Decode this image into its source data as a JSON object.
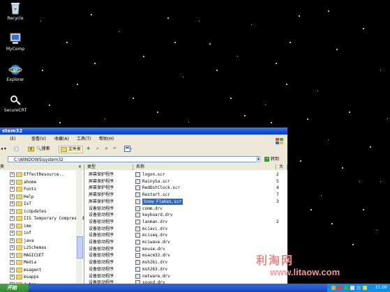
{
  "desktop": {
    "icons": [
      {
        "label": "Recycle",
        "icon": "recycle-bin-icon"
      },
      {
        "label": "MyComp",
        "icon": "my-computer-icon"
      },
      {
        "label": "Explorer",
        "icon": "internet-explorer-icon"
      },
      {
        "label": "SecureCRT",
        "icon": "securecrt-icon"
      }
    ]
  },
  "window": {
    "title": "stem32",
    "menu": [
      "(E)",
      "查看(V)",
      "收藏(A)",
      "工具(T)",
      "帮助(H)"
    ],
    "toolbar": {
      "search_label": "搜索",
      "folders_label": "文件夹"
    },
    "address": {
      "value": "C:\\WINDOWS\\system32",
      "go_label": "转到"
    },
    "left_header": "夹",
    "tree": [
      {
        "label": "EffectResource.."
      },
      {
        "label": "ahome"
      },
      {
        "label": "Fonts"
      },
      {
        "label": "Help"
      },
      {
        "label": "IsT"
      },
      {
        "label": "icUpdates"
      },
      {
        "label": "IIS Temporary Compressed"
      },
      {
        "label": "ime"
      },
      {
        "label": "inf"
      },
      {
        "label": "java"
      },
      {
        "label": "L2Schemas"
      },
      {
        "label": "MAGICSET"
      },
      {
        "label": "Media"
      },
      {
        "label": "msagent"
      },
      {
        "label": "msapps"
      },
      {
        "label": "d_tmp"
      }
    ],
    "columns": {
      "type": "类型",
      "name": "名称",
      "size": "大"
    },
    "files": [
      {
        "type": "屏幕保护程序",
        "name": "logon.scr",
        "size": "2"
      },
      {
        "type": "屏幕保护程序",
        "name": "RainySa.scr",
        "size": "5"
      },
      {
        "type": "屏幕保护程序",
        "name": "RedDotClock.scr",
        "size": "4"
      },
      {
        "type": "屏幕保护程序",
        "name": "Restart.scr",
        "size": "7"
      },
      {
        "type": "屏幕保护程序",
        "name": "Snow Flakes.scr",
        "size": "3",
        "selected": true
      },
      {
        "type": "设备驱动程序",
        "name": "comm.drv",
        "size": ""
      },
      {
        "type": "设备驱动程序",
        "name": "keyboard.drv",
        "size": ""
      },
      {
        "type": "设备驱动程序",
        "name": "lanman.drv",
        "size": "2"
      },
      {
        "type": "设备驱动程序",
        "name": "mciavi.drv",
        "size": ""
      },
      {
        "type": "设备驱动程序",
        "name": "mciseq.drv",
        "size": ""
      },
      {
        "type": "设备驱动程序",
        "name": "mciwave.drv",
        "size": ""
      },
      {
        "type": "设备驱动程序",
        "name": "mouse.drv",
        "size": ""
      },
      {
        "type": "设备驱动程序",
        "name": "msacm32.drv",
        "size": ""
      },
      {
        "type": "设备驱动程序",
        "name": "msh261.drv",
        "size": ""
      },
      {
        "type": "设备驱动程序",
        "name": "msh263.drv",
        "size": ""
      },
      {
        "type": "设备驱动程序",
        "name": "netware.drv",
        "size": ""
      },
      {
        "type": "设备驱动程序",
        "name": "sound.drv",
        "size": ""
      }
    ]
  },
  "taskbar": {
    "start_label": "开始",
    "clock": "21:00"
  },
  "watermark": {
    "line1": "利淘网",
    "line2": "www.litaow.com"
  }
}
